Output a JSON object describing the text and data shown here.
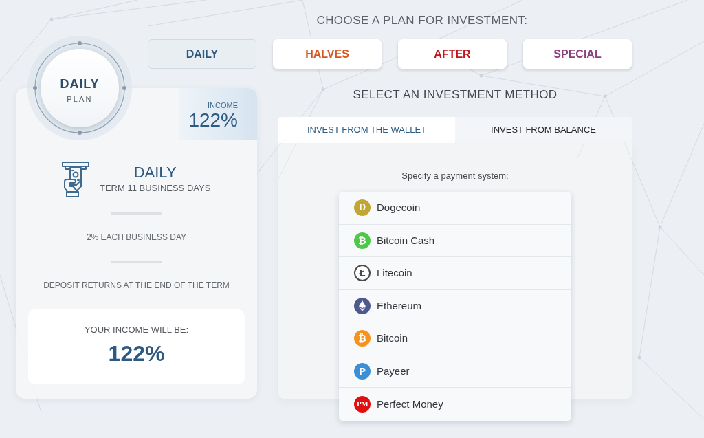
{
  "plan_heading": "CHOOSE A PLAN FOR INVESTMENT:",
  "plans": [
    {
      "label": "DAILY",
      "color": "#2d5a80",
      "selected": true
    },
    {
      "label": "HALVES",
      "color": "#d9541e",
      "selected": false
    },
    {
      "label": "AFTER",
      "color": "#c0161e",
      "selected": false
    },
    {
      "label": "SPECIAL",
      "color": "#8b3f7f",
      "selected": false
    }
  ],
  "plan_card": {
    "badge": {
      "title": "DAILY",
      "subtitle": "PLAN"
    },
    "income": {
      "label": "INCOME",
      "value": "122%"
    },
    "name": "DAILY",
    "term": "TERM 11 BUSINESS DAYS",
    "rate": "2% EACH BUSINESS DAY",
    "deposit_note": "DEPOSIT RETURNS AT THE END OF THE TERM",
    "result": {
      "label": "YOUR INCOME WILL BE:",
      "value": "122%"
    }
  },
  "method_heading": "SELECT AN INVESTMENT METHOD",
  "methods": [
    {
      "label": "INVEST FROM THE WALLET",
      "selected": true
    },
    {
      "label": "INVEST FROM BALANCE",
      "selected": false
    }
  ],
  "payment_prompt": "Specify a payment system:",
  "payment_systems": [
    {
      "name": "Dogecoin",
      "kind": "disc",
      "mark": "D",
      "color": "#c2a633"
    },
    {
      "name": "Bitcoin Cash",
      "kind": "disc",
      "mark": "₿",
      "color": "#4cc947"
    },
    {
      "name": "Litecoin",
      "kind": "ring",
      "mark": "Ł",
      "color": "#4a4a4a"
    },
    {
      "name": "Ethereum",
      "kind": "diamond",
      "color": "#4e5a8c"
    },
    {
      "name": "Bitcoin",
      "kind": "disc",
      "mark": "₿",
      "color": "#f7931a"
    },
    {
      "name": "Payeer",
      "kind": "disc",
      "mark": "P",
      "color": "#3a8fd6"
    },
    {
      "name": "Perfect Money",
      "kind": "disc",
      "mark": "PM",
      "color": "#e01010"
    }
  ]
}
